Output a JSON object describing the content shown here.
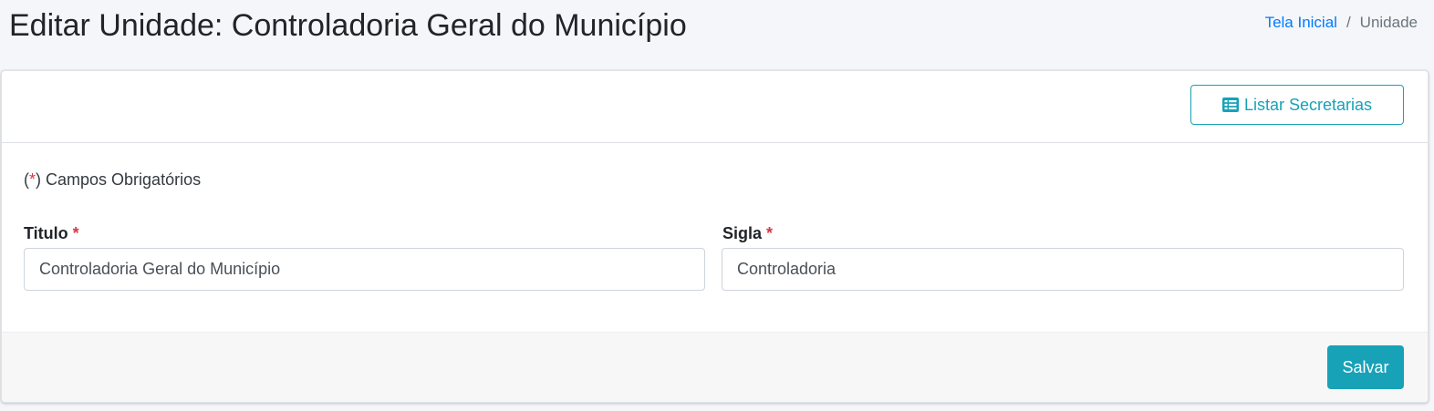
{
  "page": {
    "title": "Editar Unidade: Controladoria Geral do Município"
  },
  "breadcrumb": {
    "home_label": "Tela Inicial",
    "separator": "/",
    "current_label": "Unidade"
  },
  "header": {
    "list_button_label": "Listar Secretarias",
    "list_button_icon": "list-icon"
  },
  "form": {
    "required_note": {
      "open": "(",
      "star": "*",
      "close": ")",
      "text": " Campos Obrigatórios"
    },
    "fields": [
      {
        "label": "Titulo",
        "required_marker": "*",
        "value": "Controladoria Geral do Município"
      },
      {
        "label": "Sigla",
        "required_marker": "*",
        "value": "Controladoria"
      }
    ]
  },
  "footer": {
    "save_label": "Salvar"
  },
  "colors": {
    "accent": "#17a2b8",
    "link": "#007bff",
    "required": "#dc3545",
    "background": "#f4f6f9"
  }
}
